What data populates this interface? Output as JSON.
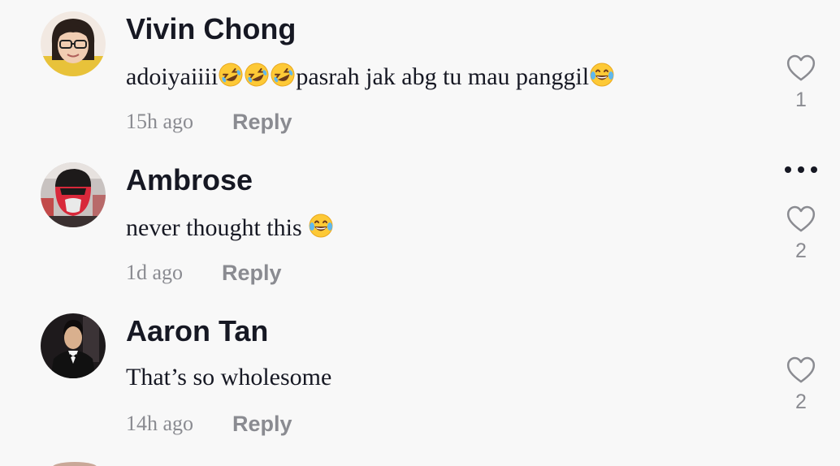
{
  "comments": [
    {
      "username": "Vivin Chong",
      "text_before": "adoiyaiiii",
      "emoji_1": "rolling-on-floor-laughing",
      "text_mid": "pasrah jak abg tu mau panggil",
      "emoji_2": "face-with-tears-of-joy",
      "time": "15h ago",
      "reply_label": "Reply",
      "likes": "1"
    },
    {
      "username": "Ambrose",
      "text": "never thought this ",
      "emoji": "face-with-tears-of-joy",
      "time": "1d ago",
      "reply_label": "Reply",
      "likes": "2"
    },
    {
      "username": "Aaron Tan",
      "text": "That’s so wholesome",
      "time": "14h ago",
      "reply_label": "Reply",
      "likes": "2"
    }
  ],
  "icons": {
    "like": "heart-outline-icon",
    "more": "more-horizontal-icon"
  },
  "colors": {
    "background": "#f8f8f8",
    "primary_text": "#161823",
    "secondary_text": "#8a8b91",
    "emoji_yellow": "#fdc936"
  }
}
